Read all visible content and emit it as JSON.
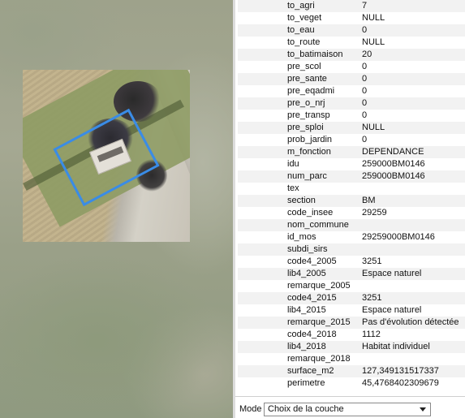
{
  "colors": {
    "selection": "#3a8ce6"
  },
  "attributes": [
    {
      "k": "to_agri",
      "v": "7"
    },
    {
      "k": "to_veget",
      "v": "NULL"
    },
    {
      "k": "to_eau",
      "v": "0"
    },
    {
      "k": "to_route",
      "v": "NULL"
    },
    {
      "k": "to_batimaison",
      "v": "20"
    },
    {
      "k": "pre_scol",
      "v": "0"
    },
    {
      "k": "pre_sante",
      "v": "0"
    },
    {
      "k": "pre_eqadmi",
      "v": "0"
    },
    {
      "k": "pre_o_nrj",
      "v": "0"
    },
    {
      "k": "pre_transp",
      "v": "0"
    },
    {
      "k": "pre_sploi",
      "v": "NULL"
    },
    {
      "k": "prob_jardin",
      "v": "0"
    },
    {
      "k": "m_fonction",
      "v": "DEPENDANCE"
    },
    {
      "k": "idu",
      "v": "259000BM0146"
    },
    {
      "k": "num_parc",
      "v": "259000BM0146"
    },
    {
      "k": "tex",
      "v": ""
    },
    {
      "k": "section",
      "v": "BM"
    },
    {
      "k": "code_insee",
      "v": "29259"
    },
    {
      "k": "nom_commune",
      "v": ""
    },
    {
      "k": "id_mos",
      "v": "29259000BM0146"
    },
    {
      "k": "subdi_sirs",
      "v": ""
    },
    {
      "k": "code4_2005",
      "v": "3251"
    },
    {
      "k": "lib4_2005",
      "v": "Espace naturel"
    },
    {
      "k": "remarque_2005",
      "v": ""
    },
    {
      "k": "code4_2015",
      "v": "3251"
    },
    {
      "k": "lib4_2015",
      "v": "Espace naturel"
    },
    {
      "k": "remarque_2015",
      "v": "Pas d'évolution détectée"
    },
    {
      "k": "code4_2018",
      "v": "1112"
    },
    {
      "k": "lib4_2018",
      "v": "Habitat individuel"
    },
    {
      "k": "remarque_2018",
      "v": ""
    },
    {
      "k": "surface_m2",
      "v": "127,349131517337"
    },
    {
      "k": "perimetre",
      "v": "45,4768402309679"
    }
  ],
  "mode": {
    "label": "Mode",
    "selected": "Choix de la couche",
    "icon": "chevron-down-icon"
  }
}
